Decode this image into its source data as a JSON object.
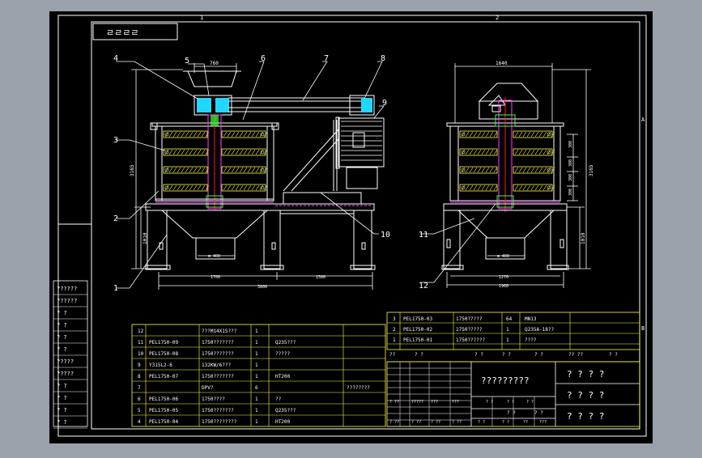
{
  "colors": {
    "background": "#9aa1ab",
    "sheet": "#000000",
    "frame": "#ffffff",
    "tableLine": "#ffff44",
    "text": "#ffffff",
    "dims": "#ffffff",
    "magenta": "#ff3bff",
    "red": "#ff2020",
    "cyan": "#22d7ff",
    "green": "#40ff40",
    "hatch": "#ffff44"
  },
  "top_ruler": {
    "left_mark": "1",
    "right_mark": "2"
  },
  "border_marks": {
    "right_top": "A",
    "right_mid": "B"
  },
  "title_stamp": "ㄹㄹㄹㄹ",
  "callouts": [
    "1",
    "2",
    "3",
    "4",
    "5",
    "6",
    "7",
    "8",
    "9",
    "10",
    "11",
    "12"
  ],
  "dimensions": {
    "top_width_left": "760",
    "top_width_right": "1640",
    "height_left": "3165",
    "height_right": "3165",
    "leg_height_left": "1010",
    "leg_height_right": "1010",
    "outlet_left": "⊞ 400",
    "outlet_right": "⊞ 400",
    "base_1": "1700",
    "base_2": "1500",
    "base_total": "3800",
    "side_base_1": "1270",
    "side_base_total": "1960",
    "vert_dims": [
      "300",
      "300",
      "300",
      "300"
    ]
  },
  "left_column": [
    "??????",
    "??????",
    "? ?",
    "? ?",
    "? ?",
    "? ?",
    "?????",
    "?????",
    "? ?",
    "? ?",
    "? ?",
    "? ?"
  ],
  "parts_list": [
    {
      "no": "12",
      "code": "",
      "name": "???M14X15???",
      "qty": "1",
      "material": "",
      "note": ""
    },
    {
      "no": "11",
      "code": "PEL1750-09",
      "name": "1750???????",
      "qty": "1",
      "material": "Q235???",
      "note": ""
    },
    {
      "no": "10",
      "code": "PEL1750-08",
      "name": "1750???????",
      "qty": "1",
      "material": "?????",
      "note": ""
    },
    {
      "no": "9",
      "code": "Y315L2-6",
      "name": "132KW/6???",
      "qty": "1",
      "material": "",
      "note": ""
    },
    {
      "no": "8",
      "code": "PEL1750-07",
      "name": "1750???????",
      "qty": "1",
      "material": "HT200",
      "note": ""
    },
    {
      "no": "7",
      "code": "",
      "name": "DPV?",
      "qty": "6",
      "material": "",
      "note": "????????"
    },
    {
      "no": "6",
      "code": "PEL1750-06",
      "name": "1750????",
      "qty": "1",
      "material": "??",
      "note": ""
    },
    {
      "no": "5",
      "code": "PEL1750-05",
      "name": "1750???????",
      "qty": "1",
      "material": "Q235???",
      "note": ""
    },
    {
      "no": "4",
      "code": "PEL1750-04",
      "name": "1750????????",
      "qty": "1",
      "material": "HT200",
      "note": ""
    }
  ],
  "parts_upper": [
    {
      "no": "3",
      "code": "PEL1750-03",
      "name": "1750?????",
      "qty": "64",
      "material": "MN13"
    },
    {
      "no": "2",
      "code": "PEL1750-02",
      "name": "1750?????",
      "qty": "1",
      "material": "Q235A-18??"
    },
    {
      "no": "1",
      "code": "PEL1750-01",
      "name": "1750??????",
      "qty": "1",
      "material": "????"
    }
  ],
  "header_row": [
    "??",
    "? ?",
    "? ?",
    "? ?",
    "? ?",
    "?? ??",
    "? ?"
  ],
  "title_block": {
    "main_title": "?????????",
    "right_title_1": "? ? ? ?",
    "right_title_2": "? ? ? ?",
    "right_title_3": "? ? ? ?",
    "row_a": [
      "? ??",
      "?????",
      "???",
      "???",
      "? ?",
      "? ?",
      "? ?"
    ],
    "row_b": [
      "? ?",
      "? ?"
    ],
    "row_c": [
      "? ??",
      "? ??",
      "? ??",
      "? ??",
      "? ?",
      "? ?",
      "??",
      "???"
    ]
  }
}
